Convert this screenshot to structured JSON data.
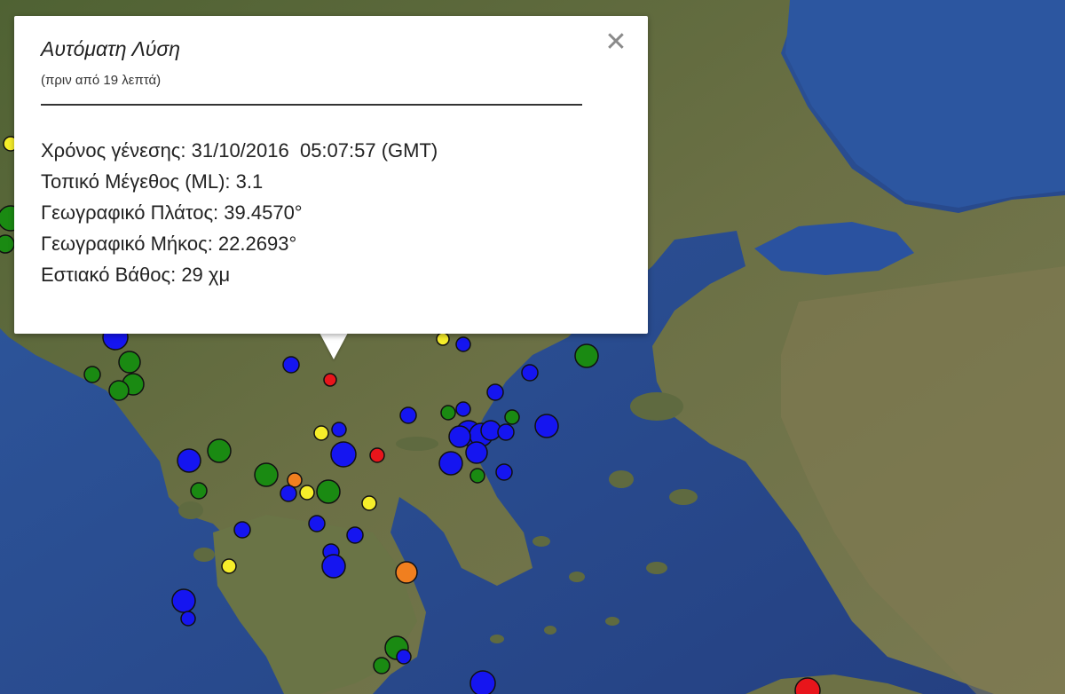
{
  "popup": {
    "title": "Αυτόματη Λύση",
    "subtitle": "(πριν από 19 λεπτά)",
    "close_glyph": "✕",
    "fields": [
      "Χρόνος γένεσης: 31/10/2016  05:07:57 (GMT)",
      "Τοπικό Μέγεθος (ML): 3.1",
      "Γεωγραφικό Πλάτος: 39.4570°",
      "Γεωγραφικό Μήκος: 22.2693°",
      "Εστιακό Βάθος: 29 χμ"
    ]
  },
  "colors": {
    "sea": "#2b4f92",
    "land": "#5b6a3c",
    "marker_red": "#e8151b",
    "marker_orange": "#f07f1f",
    "marker_yellow": "#f6ee2a",
    "marker_green": "#1a8a12",
    "marker_blue": "#1515f0"
  },
  "markers_legend_note": "",
  "icons": {
    "close": "close-icon"
  }
}
